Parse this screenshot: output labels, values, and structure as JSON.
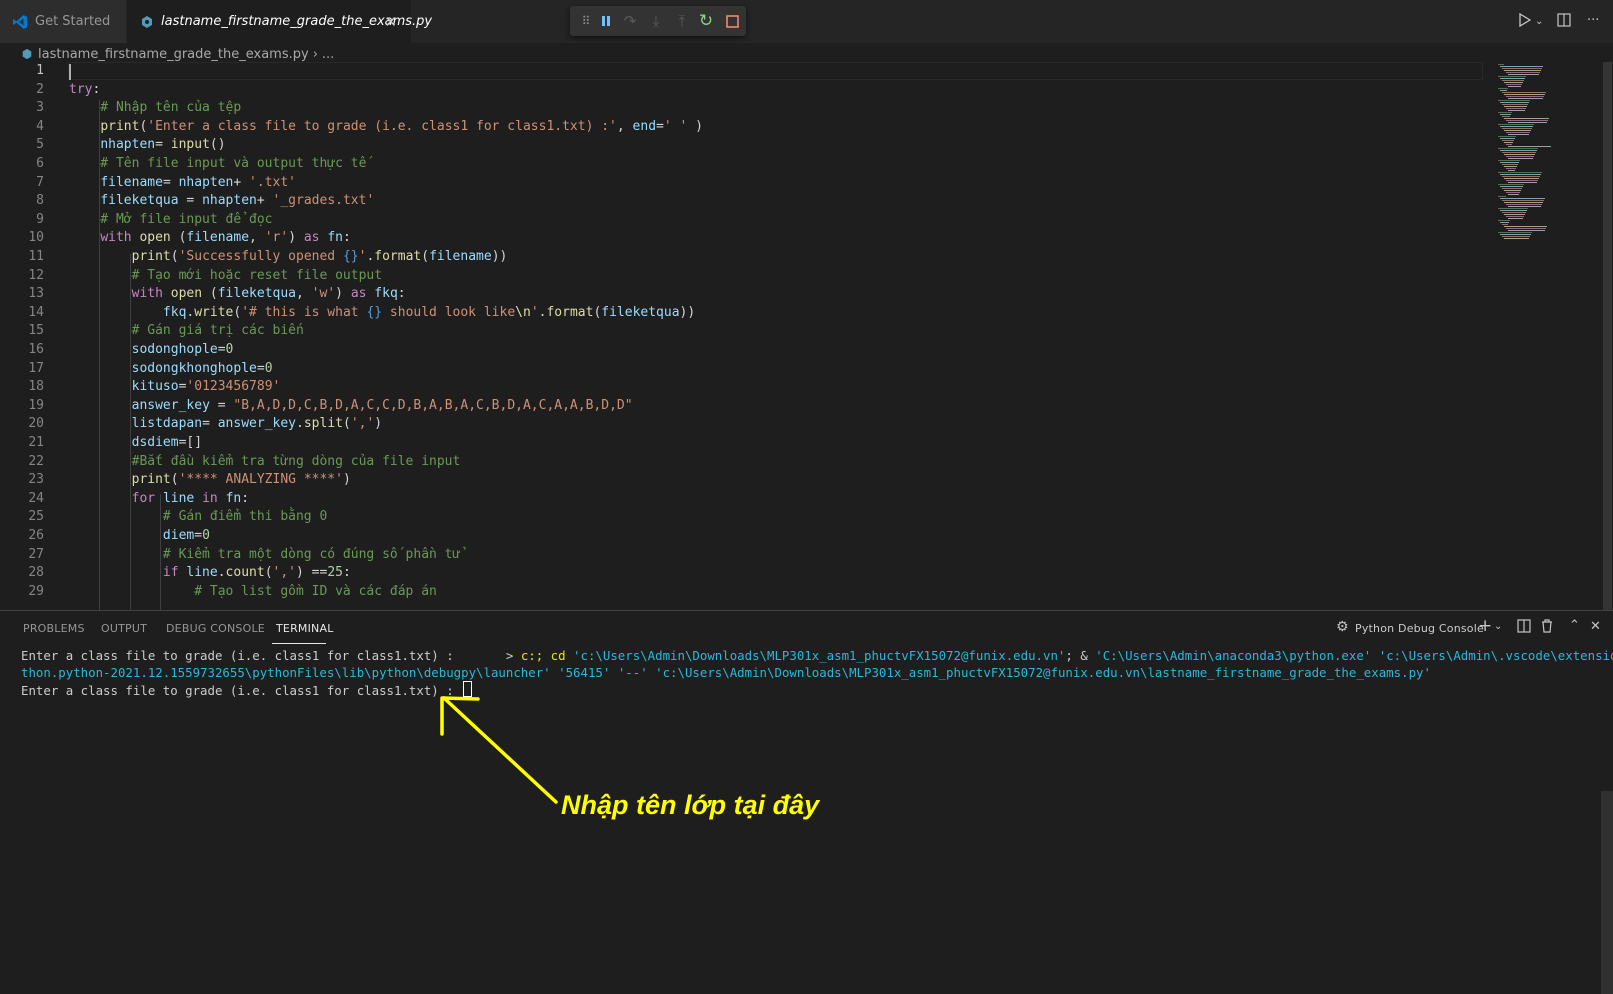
{
  "tabs": [
    {
      "label": "Get Started",
      "icon": "vscode-logo-icon"
    },
    {
      "label": "lastname_firstname_grade_the_exams.py",
      "icon": "python-file-icon",
      "active": true
    }
  ],
  "breadcrumb": {
    "file": "lastname_firstname_grade_the_exams.py",
    "ellipsis": "..."
  },
  "debug_toolbar": [
    "drag-handle-icon",
    "pause-icon",
    "step-over-icon",
    "step-into-icon",
    "step-out-icon",
    "restart-icon",
    "stop-icon"
  ],
  "editor": {
    "active_line": 1,
    "line_numbers": [
      "1",
      "2",
      "3",
      "4",
      "5",
      "6",
      "7",
      "8",
      "9",
      "10",
      "11",
      "12",
      "13",
      "14",
      "15",
      "16",
      "17",
      "18",
      "19",
      "20",
      "21",
      "22",
      "23",
      "24",
      "25",
      "26",
      "27",
      "28",
      "29"
    ],
    "lines": [
      [],
      [
        {
          "t": "try",
          "c": "k"
        },
        {
          "t": ":",
          "c": "o"
        }
      ],
      [
        {
          "t": "    # Nhập tên của tệp",
          "c": "c"
        }
      ],
      [
        {
          "t": "    ",
          "c": "o"
        },
        {
          "t": "print",
          "c": "f"
        },
        {
          "t": "(",
          "c": "o"
        },
        {
          "t": "'Enter a class file to grade (i.e. class1 for class1.txt) :'",
          "c": "s"
        },
        {
          "t": ", ",
          "c": "o"
        },
        {
          "t": "end",
          "c": "v"
        },
        {
          "t": "=",
          "c": "o"
        },
        {
          "t": "' '",
          "c": "s"
        },
        {
          "t": " )",
          "c": "o"
        }
      ],
      [
        {
          "t": "    ",
          "c": "o"
        },
        {
          "t": "nhapten",
          "c": "v"
        },
        {
          "t": "= ",
          "c": "o"
        },
        {
          "t": "input",
          "c": "f"
        },
        {
          "t": "()",
          "c": "o"
        }
      ],
      [
        {
          "t": "    # Tên file input và output thực tế",
          "c": "c"
        }
      ],
      [
        {
          "t": "    ",
          "c": "o"
        },
        {
          "t": "filename",
          "c": "v"
        },
        {
          "t": "= ",
          "c": "o"
        },
        {
          "t": "nhapten",
          "c": "v"
        },
        {
          "t": "+ ",
          "c": "o"
        },
        {
          "t": "'.txt'",
          "c": "s"
        }
      ],
      [
        {
          "t": "    ",
          "c": "o"
        },
        {
          "t": "fileketqua",
          "c": "v"
        },
        {
          "t": " = ",
          "c": "o"
        },
        {
          "t": "nhapten",
          "c": "v"
        },
        {
          "t": "+ ",
          "c": "o"
        },
        {
          "t": "'_grades.txt'",
          "c": "s"
        }
      ],
      [
        {
          "t": "    # Mở file input để đọc",
          "c": "c"
        }
      ],
      [
        {
          "t": "    ",
          "c": "o"
        },
        {
          "t": "with",
          "c": "k"
        },
        {
          "t": " ",
          "c": "o"
        },
        {
          "t": "open",
          "c": "f"
        },
        {
          "t": " (",
          "c": "o"
        },
        {
          "t": "filename",
          "c": "v"
        },
        {
          "t": ", ",
          "c": "o"
        },
        {
          "t": "'r'",
          "c": "s"
        },
        {
          "t": ") ",
          "c": "o"
        },
        {
          "t": "as",
          "c": "k"
        },
        {
          "t": " ",
          "c": "o"
        },
        {
          "t": "fn",
          "c": "v"
        },
        {
          "t": ":",
          "c": "o"
        }
      ],
      [
        {
          "t": "        ",
          "c": "o"
        },
        {
          "t": "print",
          "c": "f"
        },
        {
          "t": "(",
          "c": "o"
        },
        {
          "t": "'Successfully opened ",
          "c": "s"
        },
        {
          "t": "{}",
          "c": "b"
        },
        {
          "t": "'",
          "c": "s"
        },
        {
          "t": ".",
          "c": "o"
        },
        {
          "t": "format",
          "c": "f"
        },
        {
          "t": "(",
          "c": "o"
        },
        {
          "t": "filename",
          "c": "v"
        },
        {
          "t": "))",
          "c": "o"
        }
      ],
      [
        {
          "t": "        # Tạo mới hoặc reset file output",
          "c": "c"
        }
      ],
      [
        {
          "t": "        ",
          "c": "o"
        },
        {
          "t": "with",
          "c": "k"
        },
        {
          "t": " ",
          "c": "o"
        },
        {
          "t": "open",
          "c": "f"
        },
        {
          "t": " (",
          "c": "o"
        },
        {
          "t": "fileketqua",
          "c": "v"
        },
        {
          "t": ", ",
          "c": "o"
        },
        {
          "t": "'w'",
          "c": "s"
        },
        {
          "t": ") ",
          "c": "o"
        },
        {
          "t": "as",
          "c": "k"
        },
        {
          "t": " ",
          "c": "o"
        },
        {
          "t": "fkq",
          "c": "v"
        },
        {
          "t": ":",
          "c": "o"
        }
      ],
      [
        {
          "t": "            ",
          "c": "o"
        },
        {
          "t": "fkq",
          "c": "v"
        },
        {
          "t": ".",
          "c": "o"
        },
        {
          "t": "write",
          "c": "f"
        },
        {
          "t": "(",
          "c": "o"
        },
        {
          "t": "'# this is what ",
          "c": "s"
        },
        {
          "t": "{}",
          "c": "b"
        },
        {
          "t": " should look like",
          "c": "s"
        },
        {
          "t": "\\n",
          "c": "f"
        },
        {
          "t": "'",
          "c": "s"
        },
        {
          "t": ".",
          "c": "o"
        },
        {
          "t": "format",
          "c": "f"
        },
        {
          "t": "(",
          "c": "o"
        },
        {
          "t": "fileketqua",
          "c": "v"
        },
        {
          "t": "))",
          "c": "o"
        }
      ],
      [
        {
          "t": "        # Gán giá trị các biến",
          "c": "c"
        }
      ],
      [
        {
          "t": "        ",
          "c": "o"
        },
        {
          "t": "sodonghople",
          "c": "v"
        },
        {
          "t": "=",
          "c": "o"
        },
        {
          "t": "0",
          "c": "n"
        }
      ],
      [
        {
          "t": "        ",
          "c": "o"
        },
        {
          "t": "sodongkhonghople",
          "c": "v"
        },
        {
          "t": "=",
          "c": "o"
        },
        {
          "t": "0",
          "c": "n"
        }
      ],
      [
        {
          "t": "        ",
          "c": "o"
        },
        {
          "t": "kituso",
          "c": "v"
        },
        {
          "t": "=",
          "c": "o"
        },
        {
          "t": "'0123456789'",
          "c": "s"
        }
      ],
      [
        {
          "t": "        ",
          "c": "o"
        },
        {
          "t": "answer_key",
          "c": "v"
        },
        {
          "t": " = ",
          "c": "o"
        },
        {
          "t": "\"B,A,D,D,C,B,D,A,C,C,D,B,A,B,A,C,B,D,A,C,A,A,B,D,D\"",
          "c": "s"
        }
      ],
      [
        {
          "t": "        ",
          "c": "o"
        },
        {
          "t": "listdapan",
          "c": "v"
        },
        {
          "t": "= ",
          "c": "o"
        },
        {
          "t": "answer_key",
          "c": "v"
        },
        {
          "t": ".",
          "c": "o"
        },
        {
          "t": "split",
          "c": "f"
        },
        {
          "t": "(",
          "c": "o"
        },
        {
          "t": "','",
          "c": "s"
        },
        {
          "t": ")",
          "c": "o"
        }
      ],
      [
        {
          "t": "        ",
          "c": "o"
        },
        {
          "t": "dsdiem",
          "c": "v"
        },
        {
          "t": "=[]",
          "c": "o"
        }
      ],
      [
        {
          "t": "        #Bắt đầu kiểm tra từng dòng của file input",
          "c": "c"
        }
      ],
      [
        {
          "t": "        ",
          "c": "o"
        },
        {
          "t": "print",
          "c": "f"
        },
        {
          "t": "(",
          "c": "o"
        },
        {
          "t": "'**** ANALYZING ****'",
          "c": "s"
        },
        {
          "t": ")",
          "c": "o"
        }
      ],
      [
        {
          "t": "        ",
          "c": "o"
        },
        {
          "t": "for",
          "c": "k"
        },
        {
          "t": " ",
          "c": "o"
        },
        {
          "t": "line",
          "c": "v"
        },
        {
          "t": " ",
          "c": "o"
        },
        {
          "t": "in",
          "c": "k"
        },
        {
          "t": " ",
          "c": "o"
        },
        {
          "t": "fn",
          "c": "v"
        },
        {
          "t": ":",
          "c": "o"
        }
      ],
      [
        {
          "t": "            # Gán điểm thi bằng 0",
          "c": "c"
        }
      ],
      [
        {
          "t": "            ",
          "c": "o"
        },
        {
          "t": "diem",
          "c": "v"
        },
        {
          "t": "=",
          "c": "o"
        },
        {
          "t": "0",
          "c": "n"
        }
      ],
      [
        {
          "t": "            # Kiểm tra một dòng có đúng số phần tử",
          "c": "c"
        }
      ],
      [
        {
          "t": "            ",
          "c": "o"
        },
        {
          "t": "if",
          "c": "k"
        },
        {
          "t": " ",
          "c": "o"
        },
        {
          "t": "line",
          "c": "v"
        },
        {
          "t": ".",
          "c": "o"
        },
        {
          "t": "count",
          "c": "f"
        },
        {
          "t": "(",
          "c": "o"
        },
        {
          "t": "','",
          "c": "s"
        },
        {
          "t": ") ==",
          "c": "o"
        },
        {
          "t": "25",
          "c": "n"
        },
        {
          "t": ":",
          "c": "o"
        }
      ],
      [
        {
          "t": "                # Tạo list gồm ID và các đáp án",
          "c": "c"
        }
      ]
    ]
  },
  "panel": {
    "tabs": [
      "PROBLEMS",
      "OUTPUT",
      "DEBUG CONSOLE",
      "TERMINAL"
    ],
    "active_tab": "TERMINAL",
    "terminal_selector": "Python Debug Console",
    "actions": [
      "add-terminal-icon",
      "chevron-down-icon",
      "split-terminal-icon",
      "trash-icon",
      "maximize-panel-icon",
      "close-icon"
    ],
    "terminal_lines": [
      [
        {
          "t": "Enter a class file to grade (i.e. class1 for class1.txt) :       > ",
          "c": ""
        },
        {
          "t": "c:; cd",
          "c": "ty"
        },
        {
          "t": " ",
          "c": ""
        },
        {
          "t": "'c:\\Users\\Admin\\Downloads\\MLP301x_asm1_phuctvFX15072@funix.edu.vn'",
          "c": "tc"
        },
        {
          "t": "; & ",
          "c": ""
        },
        {
          "t": "'C:\\Users\\Admin\\anaconda3\\python.exe'",
          "c": "tc"
        },
        {
          "t": " ",
          "c": ""
        },
        {
          "t": "'c:\\Users\\Admin\\.vscode\\extensions\\ms-py",
          "c": "tc"
        }
      ],
      [
        {
          "t": "thon.python-2021.12.1559732655\\pythonFiles\\lib\\python\\debugpy\\launcher'",
          "c": "tc"
        },
        {
          "t": " ",
          "c": ""
        },
        {
          "t": "'56415'",
          "c": "tc"
        },
        {
          "t": " ",
          "c": ""
        },
        {
          "t": "'--'",
          "c": "tc"
        },
        {
          "t": " ",
          "c": ""
        },
        {
          "t": "'c:\\Users\\Admin\\Downloads\\MLP301x_asm1_phuctvFX15072@funix.edu.vn\\lastname_firstname_grade_the_exams.py'",
          "c": "tc"
        }
      ],
      [
        {
          "t": "Enter a class file to grade (i.e. class1 for class1.txt) : ",
          "c": ""
        }
      ]
    ]
  },
  "annotation": {
    "text": "Nhập tên lớp tại đây",
    "color": "#ffff00"
  }
}
